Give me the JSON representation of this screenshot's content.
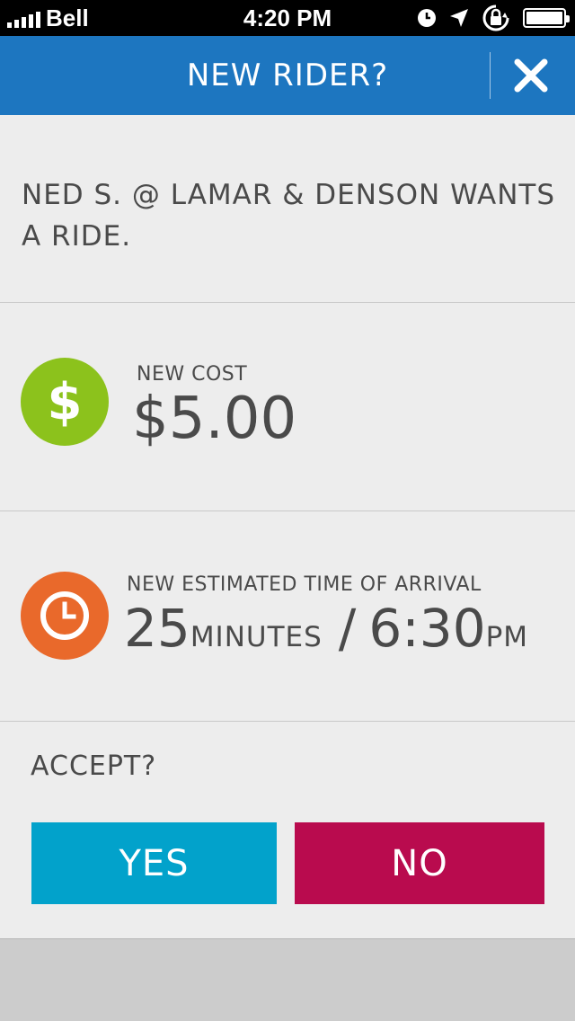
{
  "status_bar": {
    "carrier": "Bell",
    "time": "4:20 PM",
    "icons": [
      "signal-icon",
      "clock-icon",
      "location-arrow-icon",
      "rotation-lock-icon",
      "battery-icon"
    ]
  },
  "header": {
    "title": "NEW RIDER?",
    "close_icon": "close-icon"
  },
  "message": {
    "text": "NED S. @ LAMAR & DENSON WANTS A RIDE."
  },
  "cost": {
    "icon": "dollar-icon",
    "icon_glyph": "$",
    "label": "NEW COST",
    "value": "$5.00"
  },
  "eta": {
    "icon": "clock-icon",
    "label": "NEW ESTIMATED TIME OF ARRIVAL",
    "minutes": "25",
    "minutes_unit": "MINUTES",
    "separator": "/",
    "time": "6:30",
    "time_unit": "PM"
  },
  "accept": {
    "label": "ACCEPT?",
    "yes_label": "YES",
    "no_label": "NO"
  },
  "colors": {
    "header_bg": "#1d76c0",
    "cost_icon_bg": "#8cc21c",
    "eta_icon_bg": "#e9692b",
    "yes_bg": "#02a2cb",
    "no_bg": "#b90b4e",
    "page_bg": "#ededed"
  }
}
